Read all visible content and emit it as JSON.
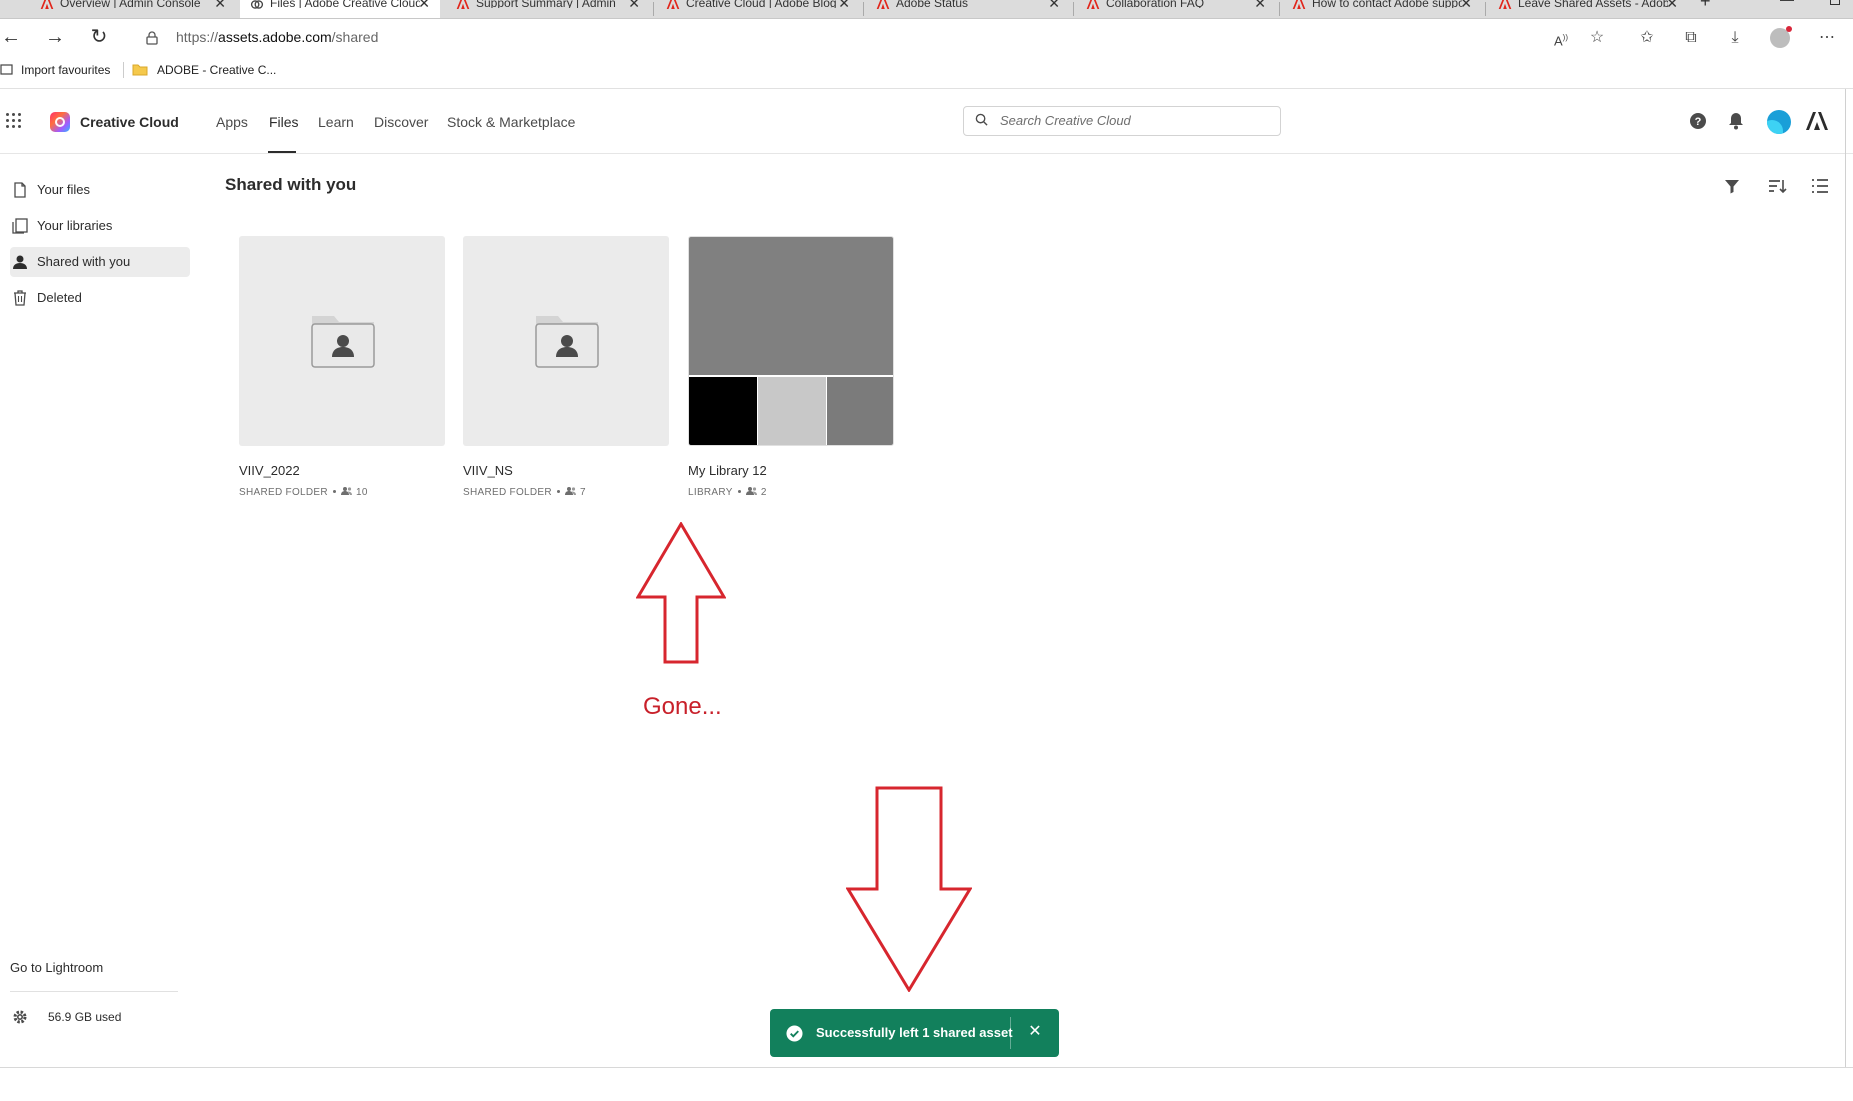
{
  "browser": {
    "tabs": [
      {
        "title": "Overview | Admin Console"
      },
      {
        "title": "Files | Adobe Creative Cloud"
      },
      {
        "title": "Support Summary | Admin"
      },
      {
        "title": "Creative Cloud | Adobe Blog"
      },
      {
        "title": "Adobe Status"
      },
      {
        "title": "Collaboration FAQ"
      },
      {
        "title": "How to contact Adobe support"
      },
      {
        "title": "Leave Shared Assets - Adobe"
      }
    ],
    "url_prefix": "https://",
    "url_host": "assets.adobe.com",
    "url_path": "/shared",
    "favourites": [
      {
        "label": "Import favourites"
      },
      {
        "label": "ADOBE - Creative C..."
      }
    ]
  },
  "app": {
    "brand": "Creative Cloud",
    "nav": [
      {
        "label": "Apps"
      },
      {
        "label": "Files"
      },
      {
        "label": "Learn"
      },
      {
        "label": "Discover"
      },
      {
        "label": "Stock & Marketplace"
      }
    ],
    "search_placeholder": "Search Creative Cloud"
  },
  "sidebar": {
    "items": [
      {
        "label": "Your files"
      },
      {
        "label": "Your libraries"
      },
      {
        "label": "Shared with you"
      },
      {
        "label": "Deleted"
      }
    ],
    "go_to_lightroom": "Go to Lightroom",
    "storage": "56.9 GB used"
  },
  "main": {
    "title": "Shared with you",
    "cards": [
      {
        "name": "VIIV_2022",
        "type": "SHARED FOLDER",
        "members": "10"
      },
      {
        "name": "VIIV_NS",
        "type": "SHARED FOLDER",
        "members": "7"
      },
      {
        "name": "My Library 12",
        "type": "LIBRARY",
        "members": "2"
      }
    ]
  },
  "annotation": {
    "text": "Gone..."
  },
  "toast": {
    "message": "Successfully left 1 shared asset"
  },
  "colors": {
    "toast": "#12805c",
    "annotation": "#c8202a"
  }
}
